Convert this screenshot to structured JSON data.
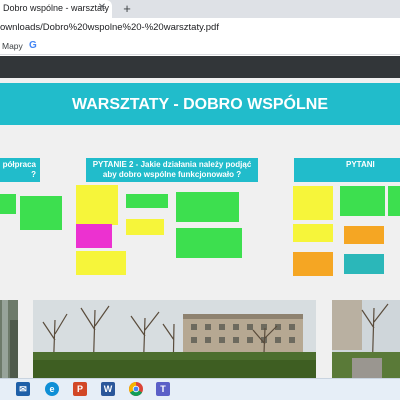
{
  "browser": {
    "tab_title": "Dobro wspólne - warsztaty",
    "tab_close_icon": "close-icon",
    "new_tab_icon": "plus-icon",
    "url": "ownloads/Dobro%20wspolne%20-%20warsztaty.pdf",
    "bookmarks": [
      {
        "label": "Mapy"
      },
      {
        "label": "G",
        "icon": "google-icon"
      }
    ]
  },
  "pdf": {
    "title": "WARSZTATY - DOBRO WSPÓLNE",
    "questions": [
      {
        "text": "półpraca ?"
      },
      {
        "text": "PYTANIE 2 - Jakie działania należy podjąć aby dobro wspólne funkcjonowało ?"
      },
      {
        "text": "PYTANI"
      }
    ],
    "note_colors": {
      "yellow": "#f6f53a",
      "green": "#3ddf4f",
      "orange": "#f5a623",
      "magenta": "#ec31d0",
      "teal": "#2bb7b9",
      "header": "#21bccb"
    }
  },
  "taskbar": {
    "icons": [
      "mail-icon",
      "edge-icon",
      "powerpoint-icon",
      "word-icon",
      "chrome-icon",
      "teams-icon"
    ]
  }
}
